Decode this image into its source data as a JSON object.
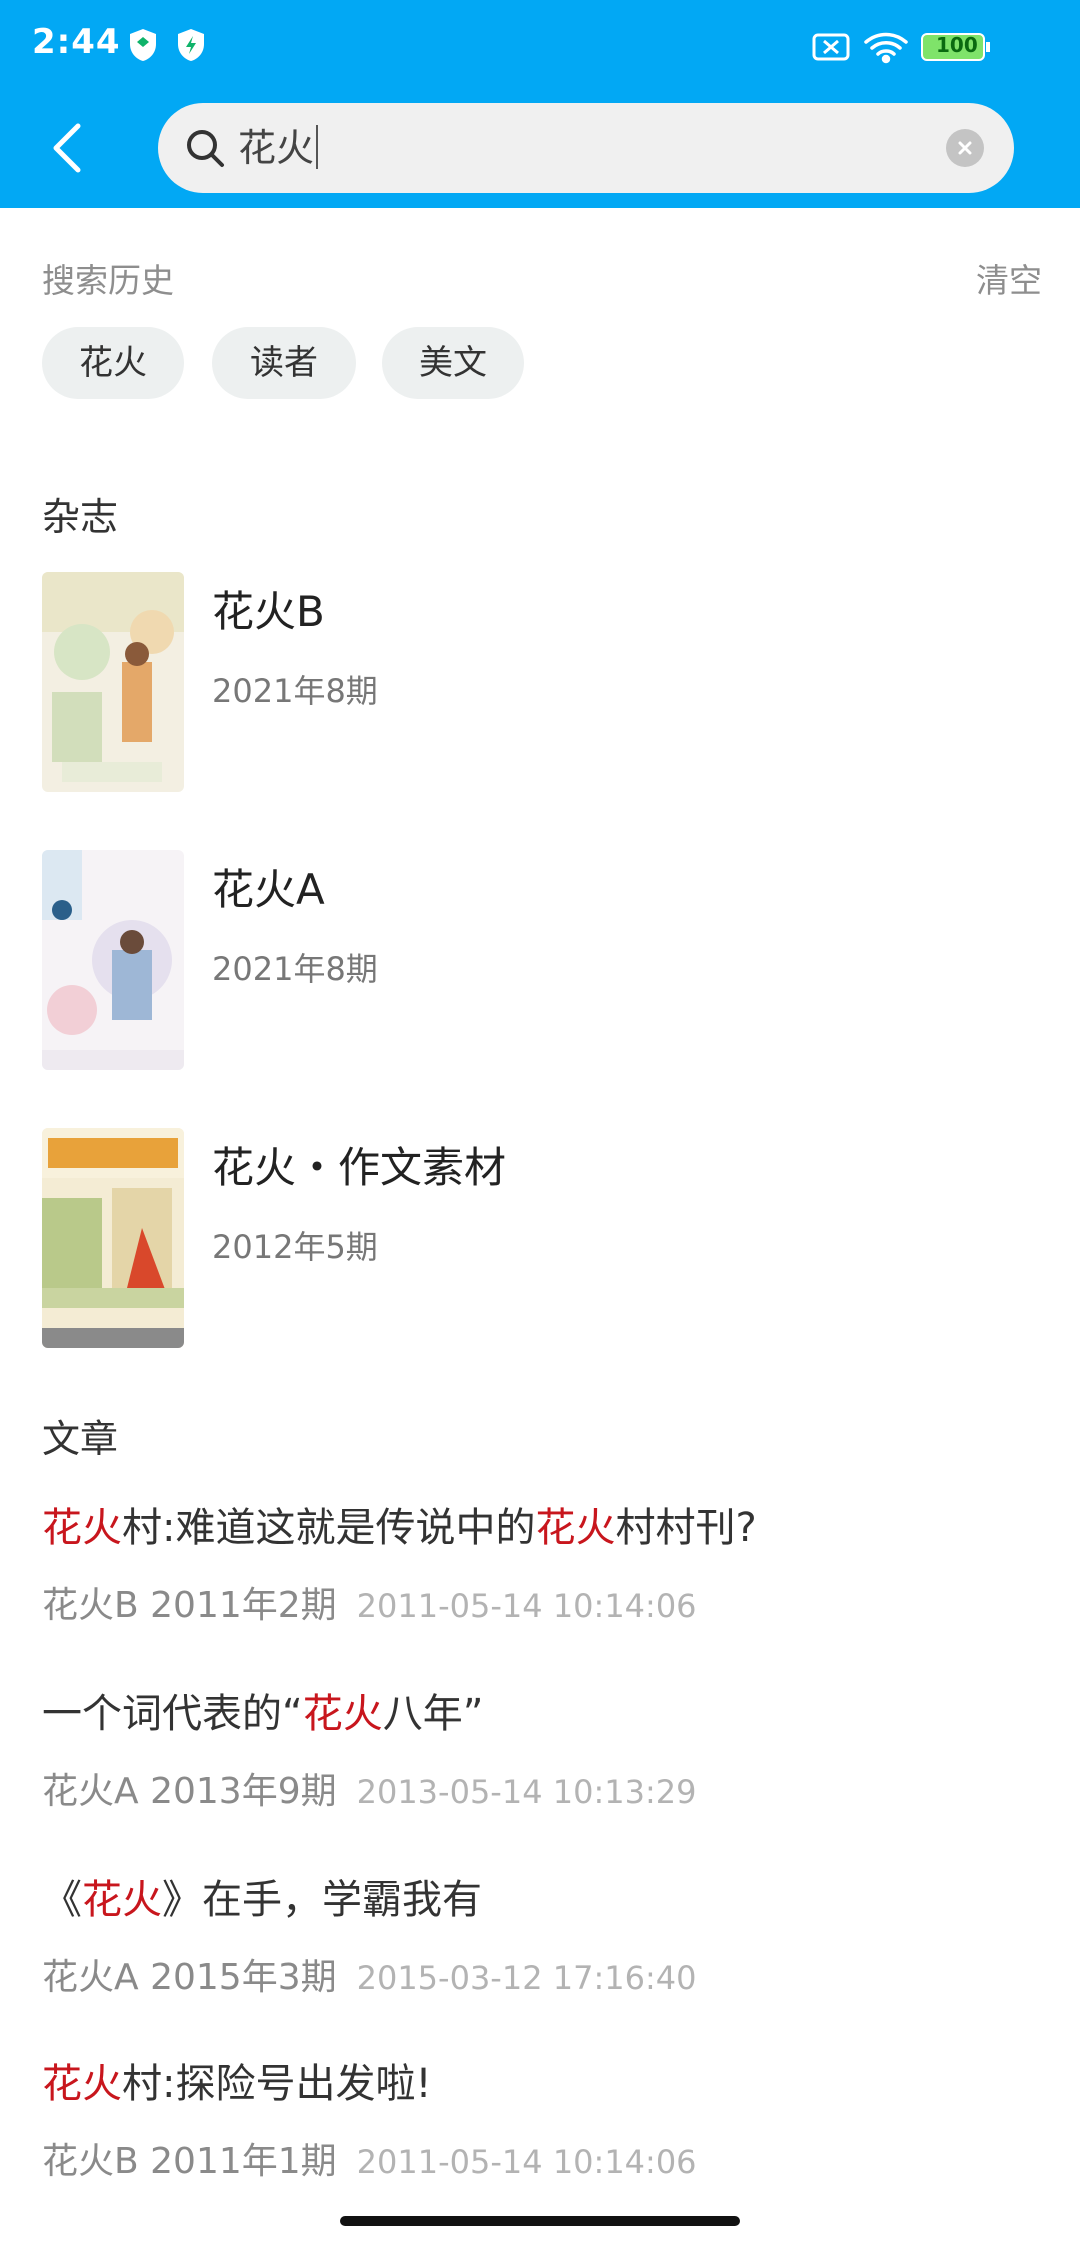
{
  "status_bar": {
    "time": "2:44",
    "battery": "100"
  },
  "search": {
    "query": "花火"
  },
  "history": {
    "label": "搜索历史",
    "clear_label": "清空",
    "chips": [
      "花火",
      "读者",
      "美文"
    ]
  },
  "magazines": {
    "label": "杂志",
    "items": [
      {
        "title": "花火B",
        "issue": "2021年8期"
      },
      {
        "title": "花火A",
        "issue": "2021年8期"
      },
      {
        "title": "花火・作文素材",
        "issue": "2012年5期"
      }
    ]
  },
  "articles": {
    "label": "文章",
    "items": [
      {
        "pre": "",
        "hl1": "花火",
        "mid": "村:难道这就是传说中的",
        "hl2": "花火",
        "post": "村村刊?",
        "source": "花火B 2011年2期",
        "date": "2011-05-14 10:14:06"
      },
      {
        "pre": "一个词代表的“",
        "hl1": "花火",
        "mid": "八年”",
        "hl2": "",
        "post": "",
        "source": "花火A 2013年9期",
        "date": "2013-05-14 10:13:29"
      },
      {
        "pre": "《",
        "hl1": "花火",
        "mid": "》在手，学霸我有",
        "hl2": "",
        "post": "",
        "source": "花火A 2015年3期",
        "date": "2015-03-12 17:16:40"
      },
      {
        "pre": "",
        "hl1": "花火",
        "mid": "村:探险号出发啦!",
        "hl2": "",
        "post": "",
        "source": "花火B 2011年1期",
        "date": "2011-05-14 10:14:06"
      }
    ]
  },
  "colors": {
    "header": "#02a8f4",
    "highlight": "#c8161d"
  }
}
